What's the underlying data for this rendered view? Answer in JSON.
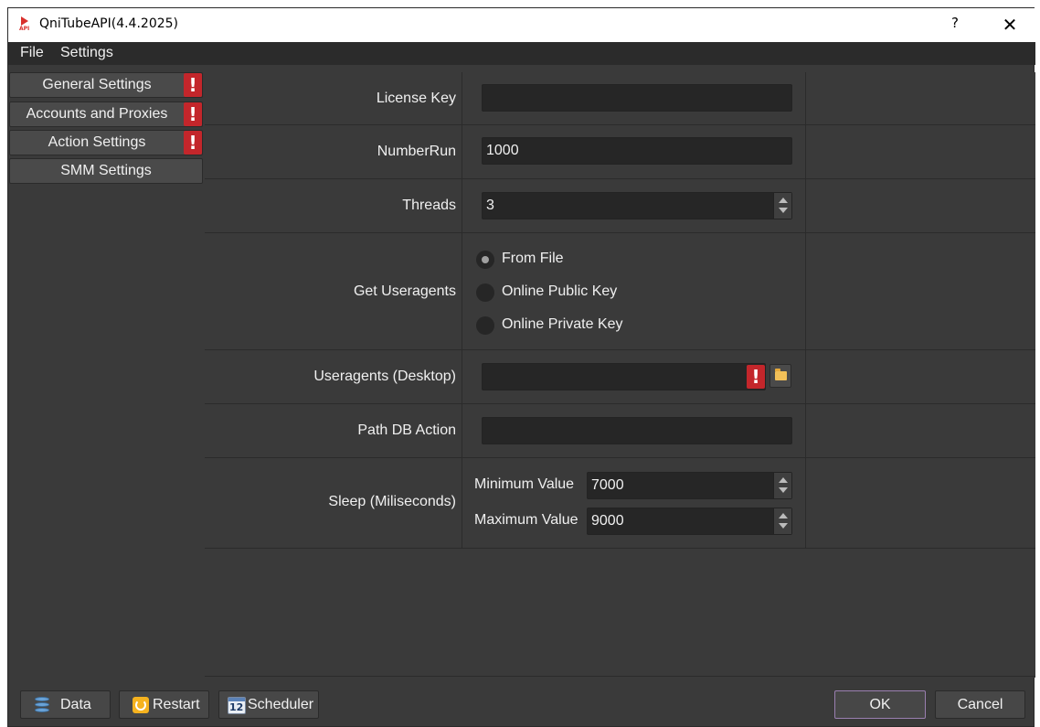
{
  "window": {
    "title": "QniTubeAPI(4.4.2025)",
    "app_icon_text": "API",
    "help_glyph": "?",
    "close_glyph": "✕"
  },
  "menu": {
    "file": "File",
    "settings": "Settings"
  },
  "sidebar": {
    "items": [
      {
        "label": "General Settings",
        "warning": true
      },
      {
        "label": "Accounts and Proxies",
        "warning": true
      },
      {
        "label": "Action Settings",
        "warning": true
      },
      {
        "label": "SMM Settings",
        "warning": false
      }
    ],
    "warning_glyph": "!"
  },
  "form": {
    "license_key": {
      "label": "License Key",
      "value": ""
    },
    "number_run": {
      "label": "NumberRun",
      "value": "1000"
    },
    "threads": {
      "label": "Threads",
      "value": "3"
    },
    "get_useragents": {
      "label": "Get Useragents",
      "options": [
        "From File",
        "Online Public Key",
        "Online Private Key"
      ],
      "selected": "From File"
    },
    "useragents_desktop": {
      "label": "Useragents (Desktop)",
      "value": "",
      "warning": true
    },
    "path_db_action": {
      "label": "Path DB Action",
      "value": ""
    },
    "sleep": {
      "label": "Sleep (Miliseconds)",
      "min_label": "Minimum Value",
      "min_value": "7000",
      "max_label": "Maximum Value",
      "max_value": "9000"
    }
  },
  "footer": {
    "data_label": "Data",
    "restart_label": "Restart",
    "scheduler_label": "Scheduler",
    "scheduler_icon_text": "12",
    "ok_label": "OK",
    "cancel_label": "Cancel"
  },
  "colors": {
    "background": "#3a3a3a",
    "field": "#262626",
    "warning": "#c3262b",
    "ok_border": "#9a7fb0"
  }
}
